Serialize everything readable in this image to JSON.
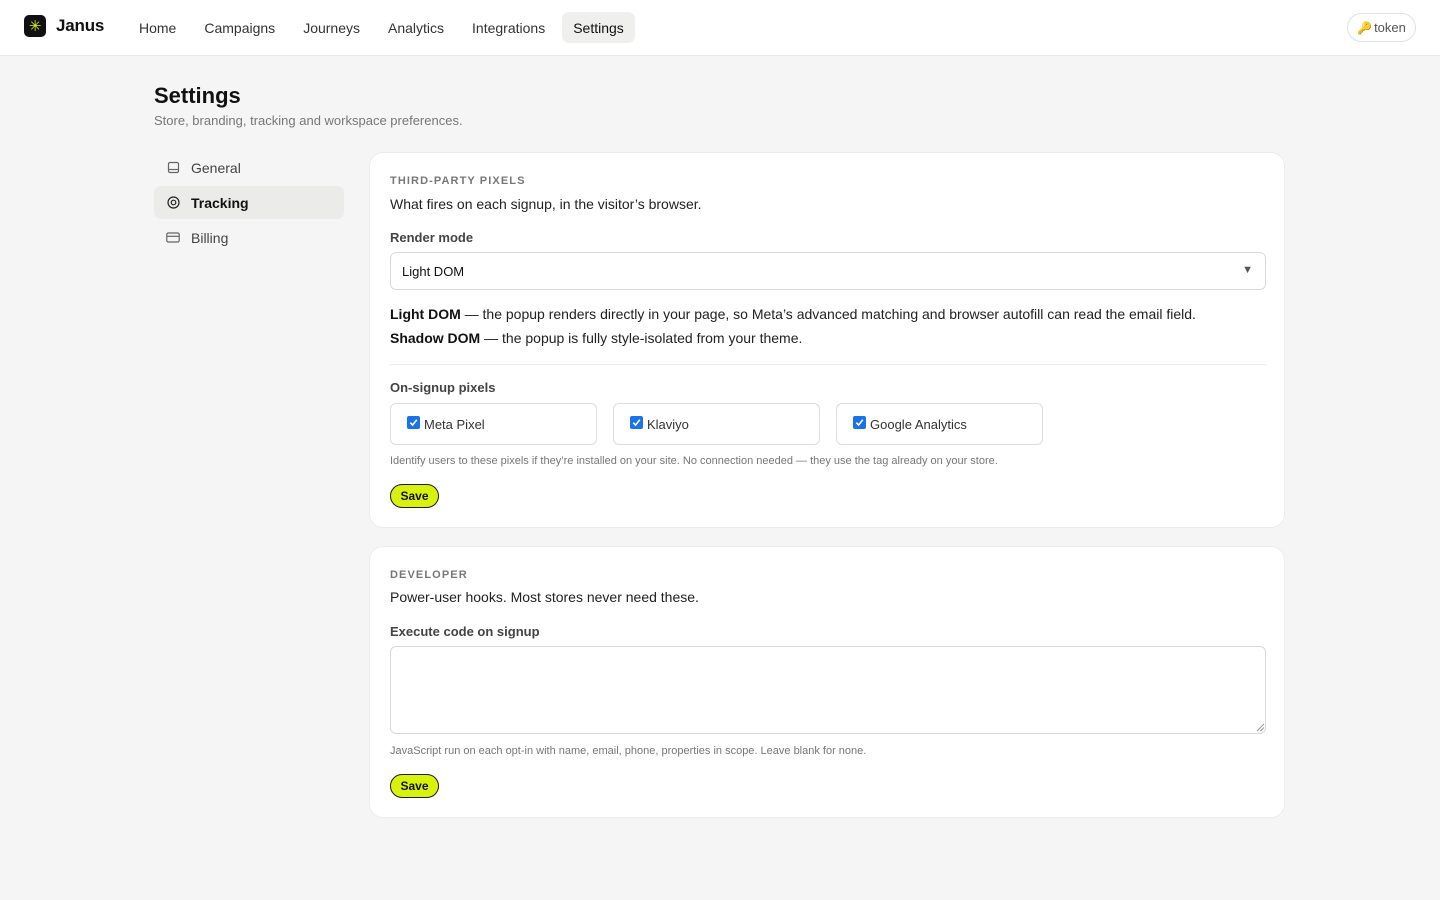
{
  "app": {
    "name": "Janus",
    "logo_glyph": "✳"
  },
  "nav": {
    "items": [
      {
        "label": "Home"
      },
      {
        "label": "Campaigns"
      },
      {
        "label": "Journeys"
      },
      {
        "label": "Analytics"
      },
      {
        "label": "Integrations"
      },
      {
        "label": "Settings"
      }
    ],
    "active": "Settings",
    "token_label": "token",
    "token_icon": "key-icon"
  },
  "page": {
    "title": "Settings",
    "subtitle": "Store, branding, tracking and workspace preferences."
  },
  "sidebar": {
    "items": [
      {
        "label": "General",
        "icon": "store-icon"
      },
      {
        "label": "Tracking",
        "icon": "target-icon"
      },
      {
        "label": "Billing",
        "icon": "credit-card-icon"
      }
    ],
    "active": "Tracking"
  },
  "pixels_card": {
    "eyebrow": "THIRD-PARTY PIXELS",
    "description": "What fires on each signup, in the visitor’s browser.",
    "render_mode": {
      "label": "Render mode",
      "value": "Light DOM"
    },
    "light_dom": {
      "term": "Light DOM",
      "text": " — the popup renders directly in your page, so Meta’s advanced matching and browser autofill can read the email field."
    },
    "shadow_dom": {
      "term": "Shadow DOM",
      "text": " — the popup is fully style-isolated from your theme."
    },
    "pixels_label": "On-signup pixels",
    "pixels": [
      {
        "label": "Meta Pixel",
        "checked": true
      },
      {
        "label": "Klaviyo",
        "checked": true
      },
      {
        "label": "Google Analytics",
        "checked": true
      }
    ],
    "help": "Identify users to these pixels if they’re installed on your site. No connection needed — they use the tag already on your store.",
    "save_label": "Save"
  },
  "developer_card": {
    "eyebrow": "DEVELOPER",
    "description": "Power-user hooks. Most stores never need these.",
    "code_label": "Execute code on signup",
    "code_value": "",
    "help": "JavaScript run on each opt-in with name, email, phone, properties in scope. Leave blank for none.",
    "save_label": "Save"
  },
  "colors": {
    "accent": "#d9f20c",
    "checkbox": "#1a73e8",
    "background": "#f5f5f5"
  }
}
